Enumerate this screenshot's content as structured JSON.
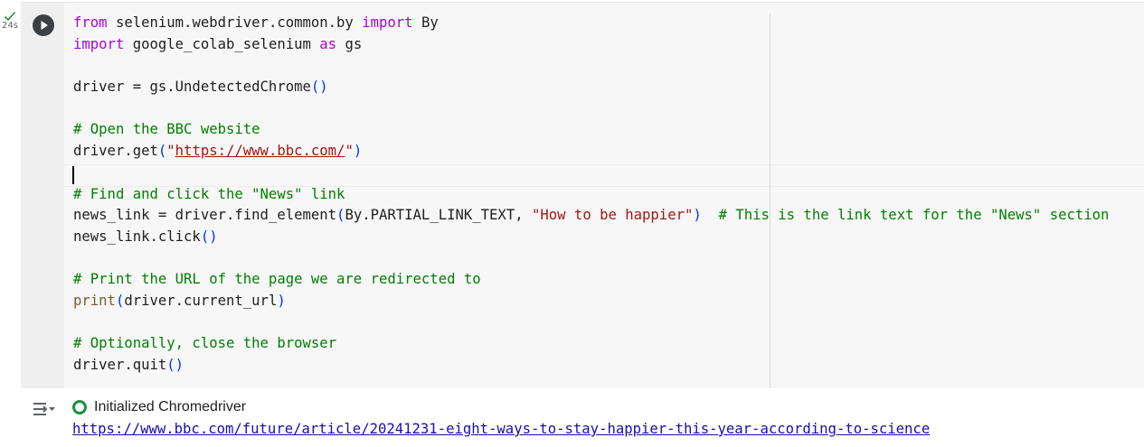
{
  "cell": {
    "execution_time": "24s",
    "code_lines": [
      [
        {
          "t": "from",
          "c": "kw"
        },
        {
          "t": " selenium.webdriver.common.by "
        },
        {
          "t": "import",
          "c": "kw"
        },
        {
          "t": " By"
        }
      ],
      [
        {
          "t": "import",
          "c": "kw"
        },
        {
          "t": " google_colab_selenium "
        },
        {
          "t": "as",
          "c": "kw"
        },
        {
          "t": " gs"
        }
      ],
      [],
      [
        {
          "t": "driver = gs.UndetectedChrome"
        },
        {
          "t": "()",
          "c": "paren"
        }
      ],
      [],
      [
        {
          "t": "# Open the BBC website",
          "c": "cmt"
        }
      ],
      [
        {
          "t": "driver.get"
        },
        {
          "t": "(",
          "c": "paren"
        },
        {
          "t": "\"",
          "c": "str"
        },
        {
          "t": "https://www.bbc.com/",
          "c": "url"
        },
        {
          "t": "\"",
          "c": "str"
        },
        {
          "t": ")",
          "c": "paren"
        }
      ],
      [],
      [
        {
          "t": "# Find and click the \"News\" link",
          "c": "cmt"
        }
      ],
      [
        {
          "t": "news_link = driver.find_element"
        },
        {
          "t": "(",
          "c": "paren"
        },
        {
          "t": "By.PARTIAL_LINK_TEXT, "
        },
        {
          "t": "\"How to be happier\"",
          "c": "str"
        },
        {
          "t": ")",
          "c": "paren"
        },
        {
          "t": "  "
        },
        {
          "t": "# This is the link text for the \"News\" section",
          "c": "cmt"
        }
      ],
      [
        {
          "t": "news_link.click"
        },
        {
          "t": "()",
          "c": "paren"
        }
      ],
      [],
      [
        {
          "t": "# Print the URL of the page we are redirected to",
          "c": "cmt"
        }
      ],
      [
        {
          "t": "print",
          "c": "fn"
        },
        {
          "t": "(",
          "c": "paren"
        },
        {
          "t": "driver.current_url"
        },
        {
          "t": ")",
          "c": "paren"
        }
      ],
      [],
      [
        {
          "t": "# Optionally, close the browser",
          "c": "cmt"
        }
      ],
      [
        {
          "t": "driver.quit",
          "c": ""
        },
        {
          "t": "()",
          "c": "paren"
        }
      ]
    ]
  },
  "output": {
    "status_text": "Initialized Chromedriver",
    "result_url": "https://www.bbc.com/future/article/20241231-eight-ways-to-stay-happier-this-year-according-to-science"
  },
  "colors": {
    "keyword": "#af00db",
    "string": "#a31515",
    "comment": "#008000",
    "bracket": "#0431fa",
    "success": "#1e8e3e",
    "link": "#1a0dab"
  },
  "icons": {
    "status": "check-icon",
    "run": "play-icon",
    "output_toggle": "output-settings-icon",
    "output_status": "success-ring-icon"
  }
}
